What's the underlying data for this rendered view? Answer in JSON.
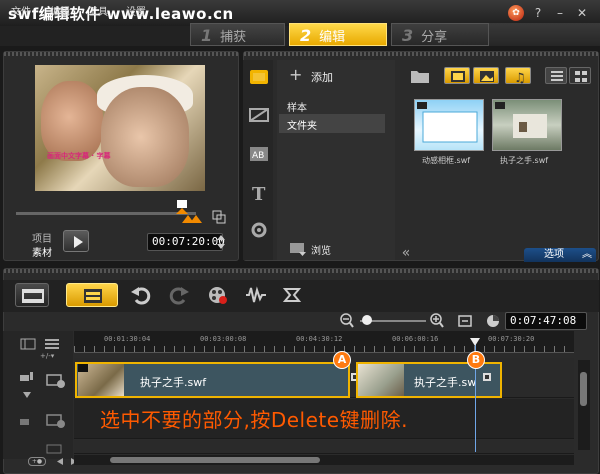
{
  "app": {
    "title": "swf编辑软件 www.leawo.cn"
  },
  "menu": [
    "文件",
    "编辑",
    "工具",
    "设置"
  ],
  "steps": [
    {
      "num": "1",
      "label": "捕获"
    },
    {
      "num": "2",
      "label": "编辑"
    },
    {
      "num": "3",
      "label": "分享"
    }
  ],
  "preview": {
    "caption": "画面中文字幕 · 字幕",
    "mode_project": "项目",
    "mode_clip": "素材",
    "timecode": "00:07:20:00"
  },
  "library": {
    "add_label": "添加",
    "folders": [
      "样本",
      "文件夹"
    ],
    "selected_folder": "文件夹",
    "browse_label": "浏览",
    "thumbnails": [
      {
        "caption": "动感相框.swf"
      },
      {
        "caption": "执子之手.swf"
      }
    ],
    "options_label": "选项"
  },
  "timeline": {
    "timecode": "0:07:47:08",
    "ruler_labels": [
      "00:01:30:04",
      "00:03:00:08",
      "00:04:30:12",
      "00:06:00:16",
      "00:07:30:20"
    ],
    "clips": [
      {
        "label": "执子之手.swf"
      },
      {
        "label": "执子之手.sw"
      }
    ],
    "marker_a": "A",
    "marker_b": "B",
    "instruction": "选中不要的部分,按Delete键删除."
  },
  "colors": {
    "accent": "#f0b400",
    "instruction": "#ff5a00",
    "options_bg": "#1d4f8a"
  }
}
